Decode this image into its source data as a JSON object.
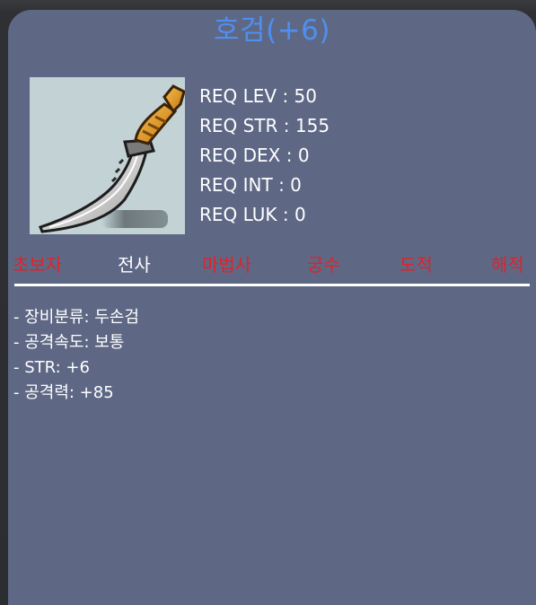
{
  "item": {
    "name": "호검(+6)",
    "icon": "curved-sword-icon"
  },
  "requirements": [
    "REQ LEV : 50",
    "REQ STR : 155",
    "REQ DEX : 0",
    "REQ INT : 0",
    "REQ LUK : 0"
  ],
  "jobs": [
    {
      "label": "초보자",
      "usable": false
    },
    {
      "label": "전사",
      "usable": true
    },
    {
      "label": "마법사",
      "usable": false
    },
    {
      "label": "궁수",
      "usable": false
    },
    {
      "label": "도적",
      "usable": false
    },
    {
      "label": "해적",
      "usable": false
    }
  ],
  "stats": [
    "- 장비분류: 두손검",
    "- 공격속도: 보통",
    "- STR: +6",
    "- 공격력: +85"
  ],
  "colors": {
    "panel_background": "#5e6885",
    "title": "#4f8ff0",
    "unavailable_job": "#e0222a",
    "available_job": "#ffffff",
    "icon_background": "#c2d2d5"
  }
}
